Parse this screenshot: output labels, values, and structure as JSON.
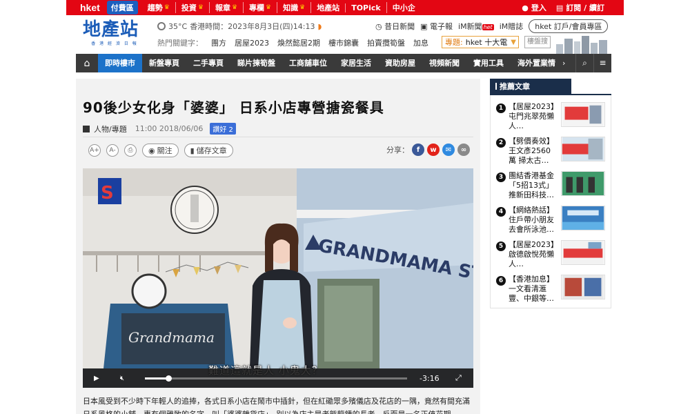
{
  "topbar": {
    "logo": "hket",
    "paid": "付費區",
    "links": [
      {
        "label": "趨勢",
        "crown": true
      },
      {
        "label": "投資",
        "crown": true
      },
      {
        "label": "報章",
        "crown": true
      },
      {
        "label": "專欄",
        "crown": true
      },
      {
        "label": "知識",
        "crown": true
      },
      {
        "label": "地產站",
        "crown": false
      },
      {
        "label": "TOPick",
        "crown": false
      },
      {
        "label": "中小企",
        "crown": false
      }
    ],
    "login": "登入",
    "subscribe": "訂閱 / 續訂"
  },
  "header": {
    "brand": "地產站",
    "brand_sub": "香 港 經 濟 日 報",
    "temperature": "35°C",
    "datetime": "香港時間：2023年8月3日(四)14:13",
    "hot_label": "熱門關鍵字：",
    "hot_keywords": [
      "團方",
      "居屋2023",
      "煥然懿居2期",
      "樓市錦囊",
      "拍賣攬筍盤",
      "加息"
    ],
    "links": [
      "昔日新聞",
      "電子報",
      "iM新聞",
      "iM贈誌"
    ],
    "het_badge": "het",
    "member_button": "hket 訂戶/會員專區",
    "topic_label": "專題:",
    "topic_value": "hket 十大電",
    "search_placeholder": "樓盤搜"
  },
  "nav": {
    "items": [
      "即時樓市",
      "新盤專頁",
      "二手專頁",
      "睇片揀筍盤",
      "工商舖車位",
      "家居生活",
      "資助房屋",
      "視頻新聞",
      "實用工具",
      "海外置業情"
    ],
    "active_index": 0
  },
  "article": {
    "title": "90後少女化身「婆婆」 日系小店專營搪瓷餐具",
    "category": "人物/專題",
    "time": "11:00 2018/06/06",
    "like_label": "讚好 2",
    "font_up": "A+",
    "font_down": "A-",
    "follow": "關注",
    "save": "儲存文章",
    "share_label": "分享：",
    "video": {
      "subtitle": "難道這就是人 小鬼大？",
      "remaining": "-3:16",
      "progress": 0.09,
      "sign_text": "GRANDMAMA STORE",
      "board_text": "Grandmama"
    },
    "body": "日本風受到不少時下年輕人的追捧，各式日系小店在鬧市中插針，但在紅磡眾多殯儀店及花店的一隅，竟然有間充滿日系風格的小舖，專有個雅致的名字，叫「婆婆雜貨店」，別以為店主是老態龍鍾的長者，反而是一名正值花期"
  },
  "sidebar": {
    "title": "推薦文章",
    "items": [
      {
        "num": "1",
        "text": "【居屋2023】屯門兆翠苑懶人…"
      },
      {
        "num": "2",
        "text": "【劈價奏效】王文彥2560萬 掃太古…"
      },
      {
        "num": "3",
        "text": "團結香港基金「5招13式」推新田科技…"
      },
      {
        "num": "4",
        "text": "【網絡熱話】住戶帶小朋友去會所泳池…"
      },
      {
        "num": "5",
        "text": "【居屋2023】啟德啟悅苑懶人…"
      },
      {
        "num": "6",
        "text": "【香港加息】一文看清滙豐、中銀等…"
      }
    ]
  },
  "colors": {
    "brand_red": "#e30613",
    "brand_blue": "#1c5db8",
    "nav_active": "#1c72c9",
    "sidebar_head": "#1a2e4a"
  }
}
